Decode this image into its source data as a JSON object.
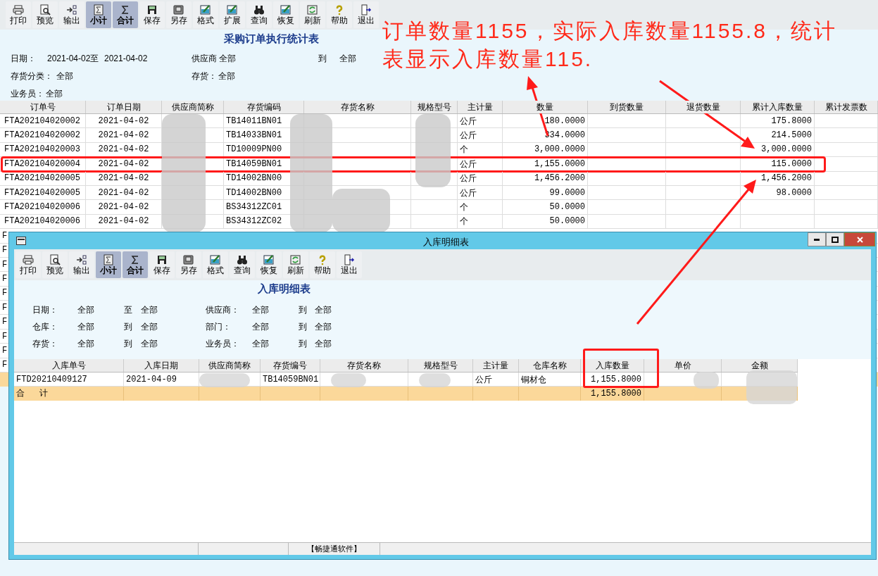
{
  "toolbar": [
    {
      "label": "打印",
      "selected": false
    },
    {
      "label": "预览",
      "selected": false
    },
    {
      "label": "输出",
      "selected": false
    },
    {
      "label": "小计",
      "selected": true
    },
    {
      "label": "合计",
      "selected": true
    },
    {
      "label": "保存",
      "selected": false
    },
    {
      "label": "另存",
      "selected": false
    },
    {
      "label": "格式",
      "selected": false
    },
    {
      "label": "扩展",
      "selected": false
    },
    {
      "label": "查询",
      "selected": false
    },
    {
      "label": "恢复",
      "selected": false
    },
    {
      "label": "刷新",
      "selected": false
    },
    {
      "label": "帮助",
      "selected": false
    },
    {
      "label": "退出",
      "selected": false
    }
  ],
  "report": {
    "title": "采购订单执行统计表",
    "filters": [
      [
        "日期：",
        "2021-04-02至",
        "2021-04-02",
        "供应商 全部",
        "到",
        "全部"
      ],
      [
        "存货分类：",
        "全部",
        "存货：",
        "全部"
      ],
      [
        "业务员：",
        "全部"
      ]
    ],
    "columns": [
      "订单号",
      "订单日期",
      "供应商简称",
      "存货编码",
      "存货名称",
      "规格型号",
      "主计量",
      "数量",
      "到货数量",
      "退货数量",
      "累计入库数量",
      "累计发票数"
    ],
    "rows": [
      {
        "order_no": "FTA202104020002",
        "date": "2021-04-02",
        "item_code": "TB14011BN01",
        "unit": "公斤",
        "quantity": "180.0000",
        "received": "175.8000",
        "highlighted": false
      },
      {
        "order_no": "FTA202104020002",
        "date": "2021-04-02",
        "item_code": "TB14033BN01",
        "unit": "公斤",
        "quantity": "334.0000",
        "received": "214.5000",
        "highlighted": false
      },
      {
        "order_no": "FTA202104020003",
        "date": "2021-04-02",
        "item_code": "TD10009PN00",
        "unit": "个",
        "quantity": "3,000.0000",
        "received": "3,000.0000",
        "highlighted": false
      },
      {
        "order_no": "FTA202104020004",
        "date": "2021-04-02",
        "item_code": "TB14059BN01",
        "unit": "公斤",
        "quantity": "1,155.0000",
        "received": "115.0000",
        "highlighted": true
      },
      {
        "order_no": "FTA202104020005",
        "date": "2021-04-02",
        "item_code": "TD14002BN00",
        "unit": "公斤",
        "quantity": "1,456.2000",
        "received": "1,456.2000",
        "highlighted": false
      },
      {
        "order_no": "FTA202104020005",
        "date": "2021-04-02",
        "item_code": "TD14002BN00",
        "unit": "公斤",
        "quantity": "99.0000",
        "received": "98.0000",
        "highlighted": false
      },
      {
        "order_no": "FTA202104020006",
        "date": "2021-04-02",
        "item_code": "BS34312ZC01",
        "unit": "个",
        "quantity": "50.0000",
        "highlighted": false
      },
      {
        "order_no": "FTA202104020006",
        "date": "2021-04-02",
        "item_code": "BS34312ZC02",
        "unit": "个",
        "quantity": "50.0000",
        "highlighted": false
      }
    ],
    "rows_behind_window": {
      "first_letters": [
        "F",
        "F",
        "F",
        "F",
        "F",
        "F",
        "F",
        "F",
        "F",
        "F"
      ]
    }
  },
  "detail_window": {
    "title": "入库明细表",
    "toolbar": [
      {
        "label": "打印",
        "selected": false
      },
      {
        "label": "预览",
        "selected": false
      },
      {
        "label": "输出",
        "selected": false
      },
      {
        "label": "小计",
        "selected": true
      },
      {
        "label": "合计",
        "selected": true
      },
      {
        "label": "保存",
        "selected": false
      },
      {
        "label": "另存",
        "selected": false
      },
      {
        "label": "格式",
        "selected": false
      },
      {
        "label": "查询",
        "selected": false
      },
      {
        "label": "恢复",
        "selected": false
      },
      {
        "label": "刷新",
        "selected": false
      },
      {
        "label": "帮助",
        "selected": false
      },
      {
        "label": "退出",
        "selected": false
      }
    ],
    "report_title": "入库明细表",
    "filters": [
      [
        "日期：",
        "全部",
        "至",
        "全部",
        "供应商：",
        "全部",
        "到",
        "全部"
      ],
      [
        "仓库：",
        "全部",
        "到",
        "全部",
        "部门：",
        "全部",
        "到",
        "全部"
      ],
      [
        "存货：",
        "全部",
        "到",
        "全部",
        "业务员：",
        "全部",
        "到",
        "全部"
      ]
    ],
    "columns": [
      {
        "label": "入库单号",
        "highlighted": false
      },
      {
        "label": "入库日期",
        "highlighted": false
      },
      {
        "label": "供应商简称",
        "highlighted": false
      },
      {
        "label": "存货编号",
        "highlighted": false
      },
      {
        "label": "存货名称",
        "highlighted": false
      },
      {
        "label": "规格型号",
        "highlighted": false
      },
      {
        "label": "主计量",
        "highlighted": false
      },
      {
        "label": "仓库名称",
        "highlighted": false
      },
      {
        "label": "入库数量",
        "highlighted": true
      },
      {
        "label": "单价",
        "highlighted": false
      },
      {
        "label": "金额",
        "highlighted": false
      }
    ],
    "rows": [
      {
        "receipt_no": "FTD20210409127",
        "date": "2021-04-09",
        "item_code": "TB14059BN01",
        "unit": "公斤",
        "warehouse": "铜材仓",
        "quantity": "1,155.8000"
      }
    ],
    "total": {
      "label": "合 计",
      "quantity": "1,155.8000"
    },
    "status_bar": "【畅捷通软件】"
  },
  "annotation": "订单数量1155，实际入库数量1155.8，统计表显示入库数量115."
}
